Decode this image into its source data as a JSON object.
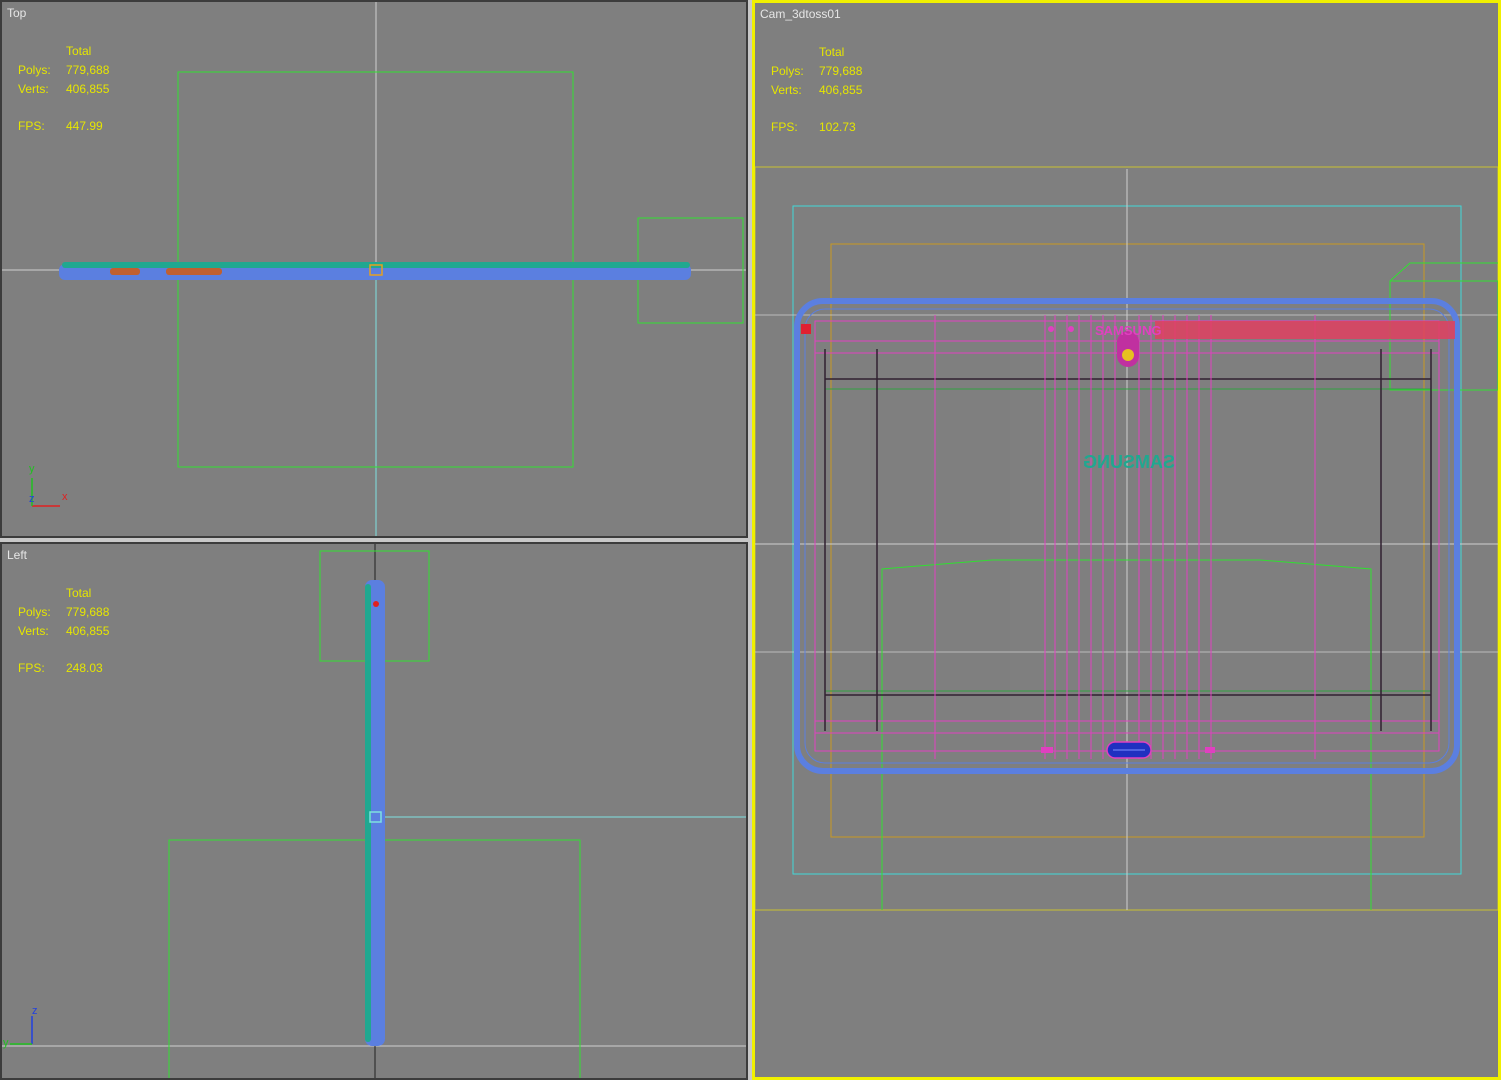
{
  "viewports": {
    "top": {
      "label": "Top",
      "total_label": "Total",
      "polys_label": "Polys:",
      "polys": "779,688",
      "verts_label": "Verts:",
      "verts": "406,855",
      "fps_label": "FPS:",
      "fps": "447.99"
    },
    "left": {
      "label": "Left",
      "total_label": "Total",
      "polys_label": "Polys:",
      "polys": "779,688",
      "verts_label": "Verts:",
      "verts": "406,855",
      "fps_label": "FPS:",
      "fps": "248.03"
    },
    "cam": {
      "label": "Cam_3dtoss01",
      "total_label": "Total",
      "polys_label": "Polys:",
      "polys": "779,688",
      "verts_label": "Verts:",
      "verts": "406,855",
      "fps_label": "FPS:",
      "fps": "102.73"
    }
  },
  "axes": {
    "top": {
      "y": "y",
      "z": "z",
      "x": "x"
    },
    "left": {
      "z": "z",
      "y": "y"
    }
  },
  "colors": {
    "viewport_bg": "#7f7f7f",
    "active_border": "#f0f000",
    "stats_text": "#e6e600",
    "grid_line": "#cfcfcf",
    "model_blue": "#5b7fe0",
    "model_teal": "#20a890",
    "wire_pink": "#e040c0",
    "light_green": "#30e030",
    "camera_cyan": "#40d8d8",
    "gizmo_orange": "#c89a20"
  },
  "model_text": {
    "brand_top": "SAMSUNG",
    "brand_mirrored": "SAMSUNG"
  }
}
